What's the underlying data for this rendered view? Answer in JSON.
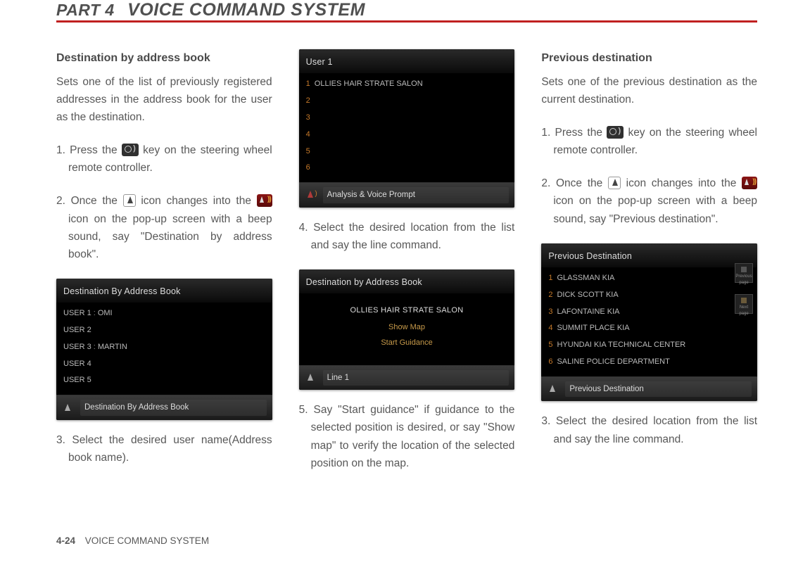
{
  "header": {
    "part": "PART 4",
    "title": "VOICE COMMAND SYSTEM"
  },
  "col1": {
    "section_title": "Destination by address book",
    "intro": "Sets one of the list of previously registered addresses in the address book for the user as the destination.",
    "step1_a": "1. Press the",
    "step1_b": "key on the steering wheel remote controller.",
    "step2_a": "2. Once the",
    "step2_b": "icon changes into the",
    "step2_c": "icon on the pop-up screen with a beep sound, say \"Destination by address book\".",
    "shot": {
      "header": "Destination By Address Book",
      "rows": [
        {
          "u": "USER 1",
          "v": "OMI"
        },
        {
          "u": "USER 2",
          "v": ""
        },
        {
          "u": "USER 3",
          "v": "MARTIN"
        },
        {
          "u": "USER 4",
          "v": ""
        },
        {
          "u": "USER 5",
          "v": ""
        }
      ],
      "footer": "Destination By Address Book"
    },
    "step3": "3. Select the desired user name(Address book name)."
  },
  "col2": {
    "shot_top": {
      "header": "User 1",
      "rows": [
        {
          "n": "1",
          "t": "OLLIES HAIR STRATE SALON"
        },
        {
          "n": "2",
          "t": ""
        },
        {
          "n": "3",
          "t": ""
        },
        {
          "n": "4",
          "t": ""
        },
        {
          "n": "5",
          "t": ""
        },
        {
          "n": "6",
          "t": ""
        }
      ],
      "footer": "Analysis & Voice Prompt"
    },
    "step4": "4. Select the desired location from the list and say the line command.",
    "shot_mid": {
      "header": "Destination by Address Book",
      "line_white": "OLLIES HAIR STRATE SALON",
      "line_gold1": "Show Map",
      "line_gold2": "Start Guidance",
      "footer": "Line 1"
    },
    "step5": "5. Say \"Start guidance\" if guidance to the selected position is desired, or say \"Show map\" to verify the location of the selected position on the map."
  },
  "col3": {
    "section_title": "Previous destination",
    "intro": "Sets one of the previous destination as the current destination.",
    "step1_a": "1. Press the",
    "step1_b": "key on the steering wheel remote controller.",
    "step2_a": "2. Once the",
    "step2_b": "icon changes into the",
    "step2_c": "icon on the pop-up screen with a beep sound, say \"Previous destination\".",
    "shot": {
      "header": "Previous Destination",
      "rows": [
        {
          "n": "1",
          "t": "GLASSMAN KIA"
        },
        {
          "n": "2",
          "t": "DICK SCOTT KIA"
        },
        {
          "n": "3",
          "t": "LAFONTAINE KIA"
        },
        {
          "n": "4",
          "t": "SUMMIT PLACE KIA"
        },
        {
          "n": "5",
          "t": "HYUNDAI KIA TECHNICAL CENTER"
        },
        {
          "n": "6",
          "t": "SALINE POLICE DEPARTMENT"
        }
      ],
      "side_prev": "Previous page",
      "side_next": "Next page",
      "footer": "Previous Destination"
    },
    "step3": "3. Select the desired location from the list and say the line command."
  },
  "footer": {
    "pageno": "4-24",
    "label": "VOICE COMMAND SYSTEM"
  }
}
